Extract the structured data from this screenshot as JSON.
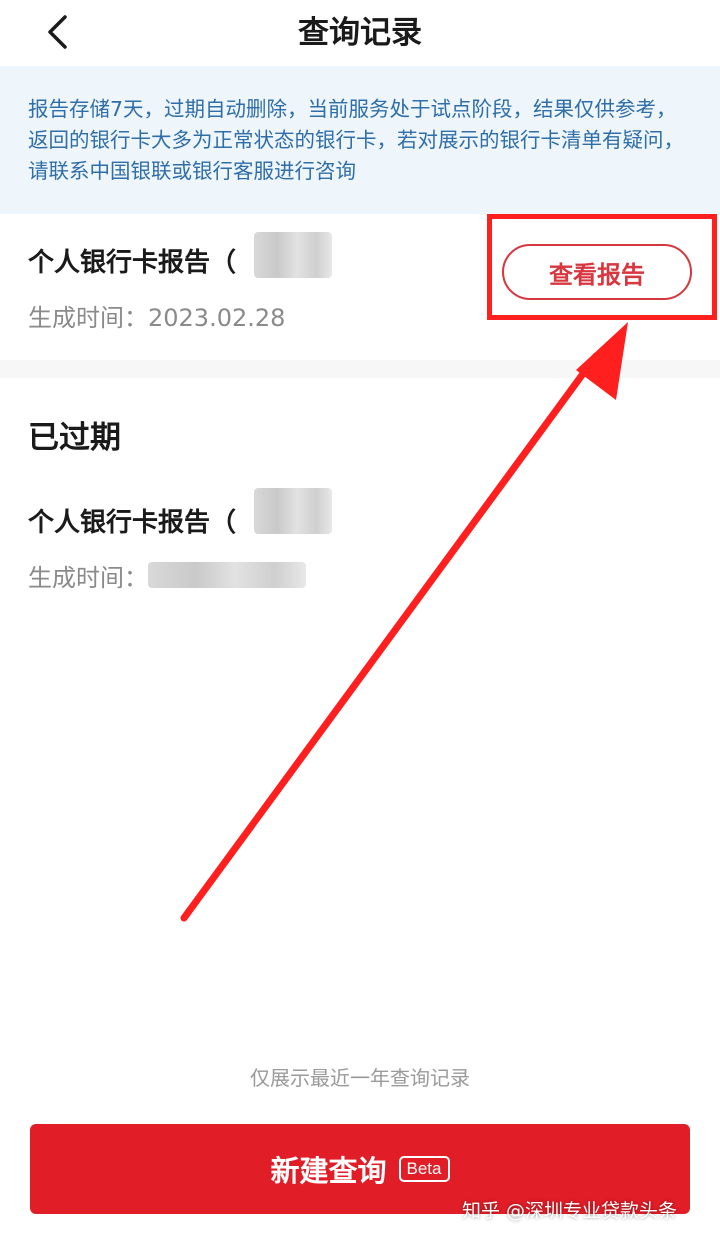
{
  "header": {
    "title": "查询记录"
  },
  "notice": {
    "text": "报告存储7天，过期自动删除，当前服务处于试点阶段，结果仅供参考，返回的银行卡大多为正常状态的银行卡，若对展示的银行卡清单有疑问，请联系中国银联或银行客服进行咨询"
  },
  "active_record": {
    "title": "个人银行卡报告（",
    "time_label": "生成时间：",
    "time_value": "2023.02.28",
    "view_button": "查看报告"
  },
  "expired": {
    "heading": "已过期",
    "record_title": "个人银行卡报告（",
    "time_label": "生成时间："
  },
  "footer": {
    "note": "仅展示最近一年查询记录",
    "new_query_button": "新建查询",
    "beta_badge": "Beta"
  },
  "watermark": "知乎 @深圳专业贷款头条",
  "icons": {
    "back": "chevron-left-icon"
  },
  "colors": {
    "accent_red": "#e11d27",
    "notice_text": "#2f6ea8",
    "notice_bg": "#eef5fb",
    "annotation_red": "#ff1f1f"
  }
}
